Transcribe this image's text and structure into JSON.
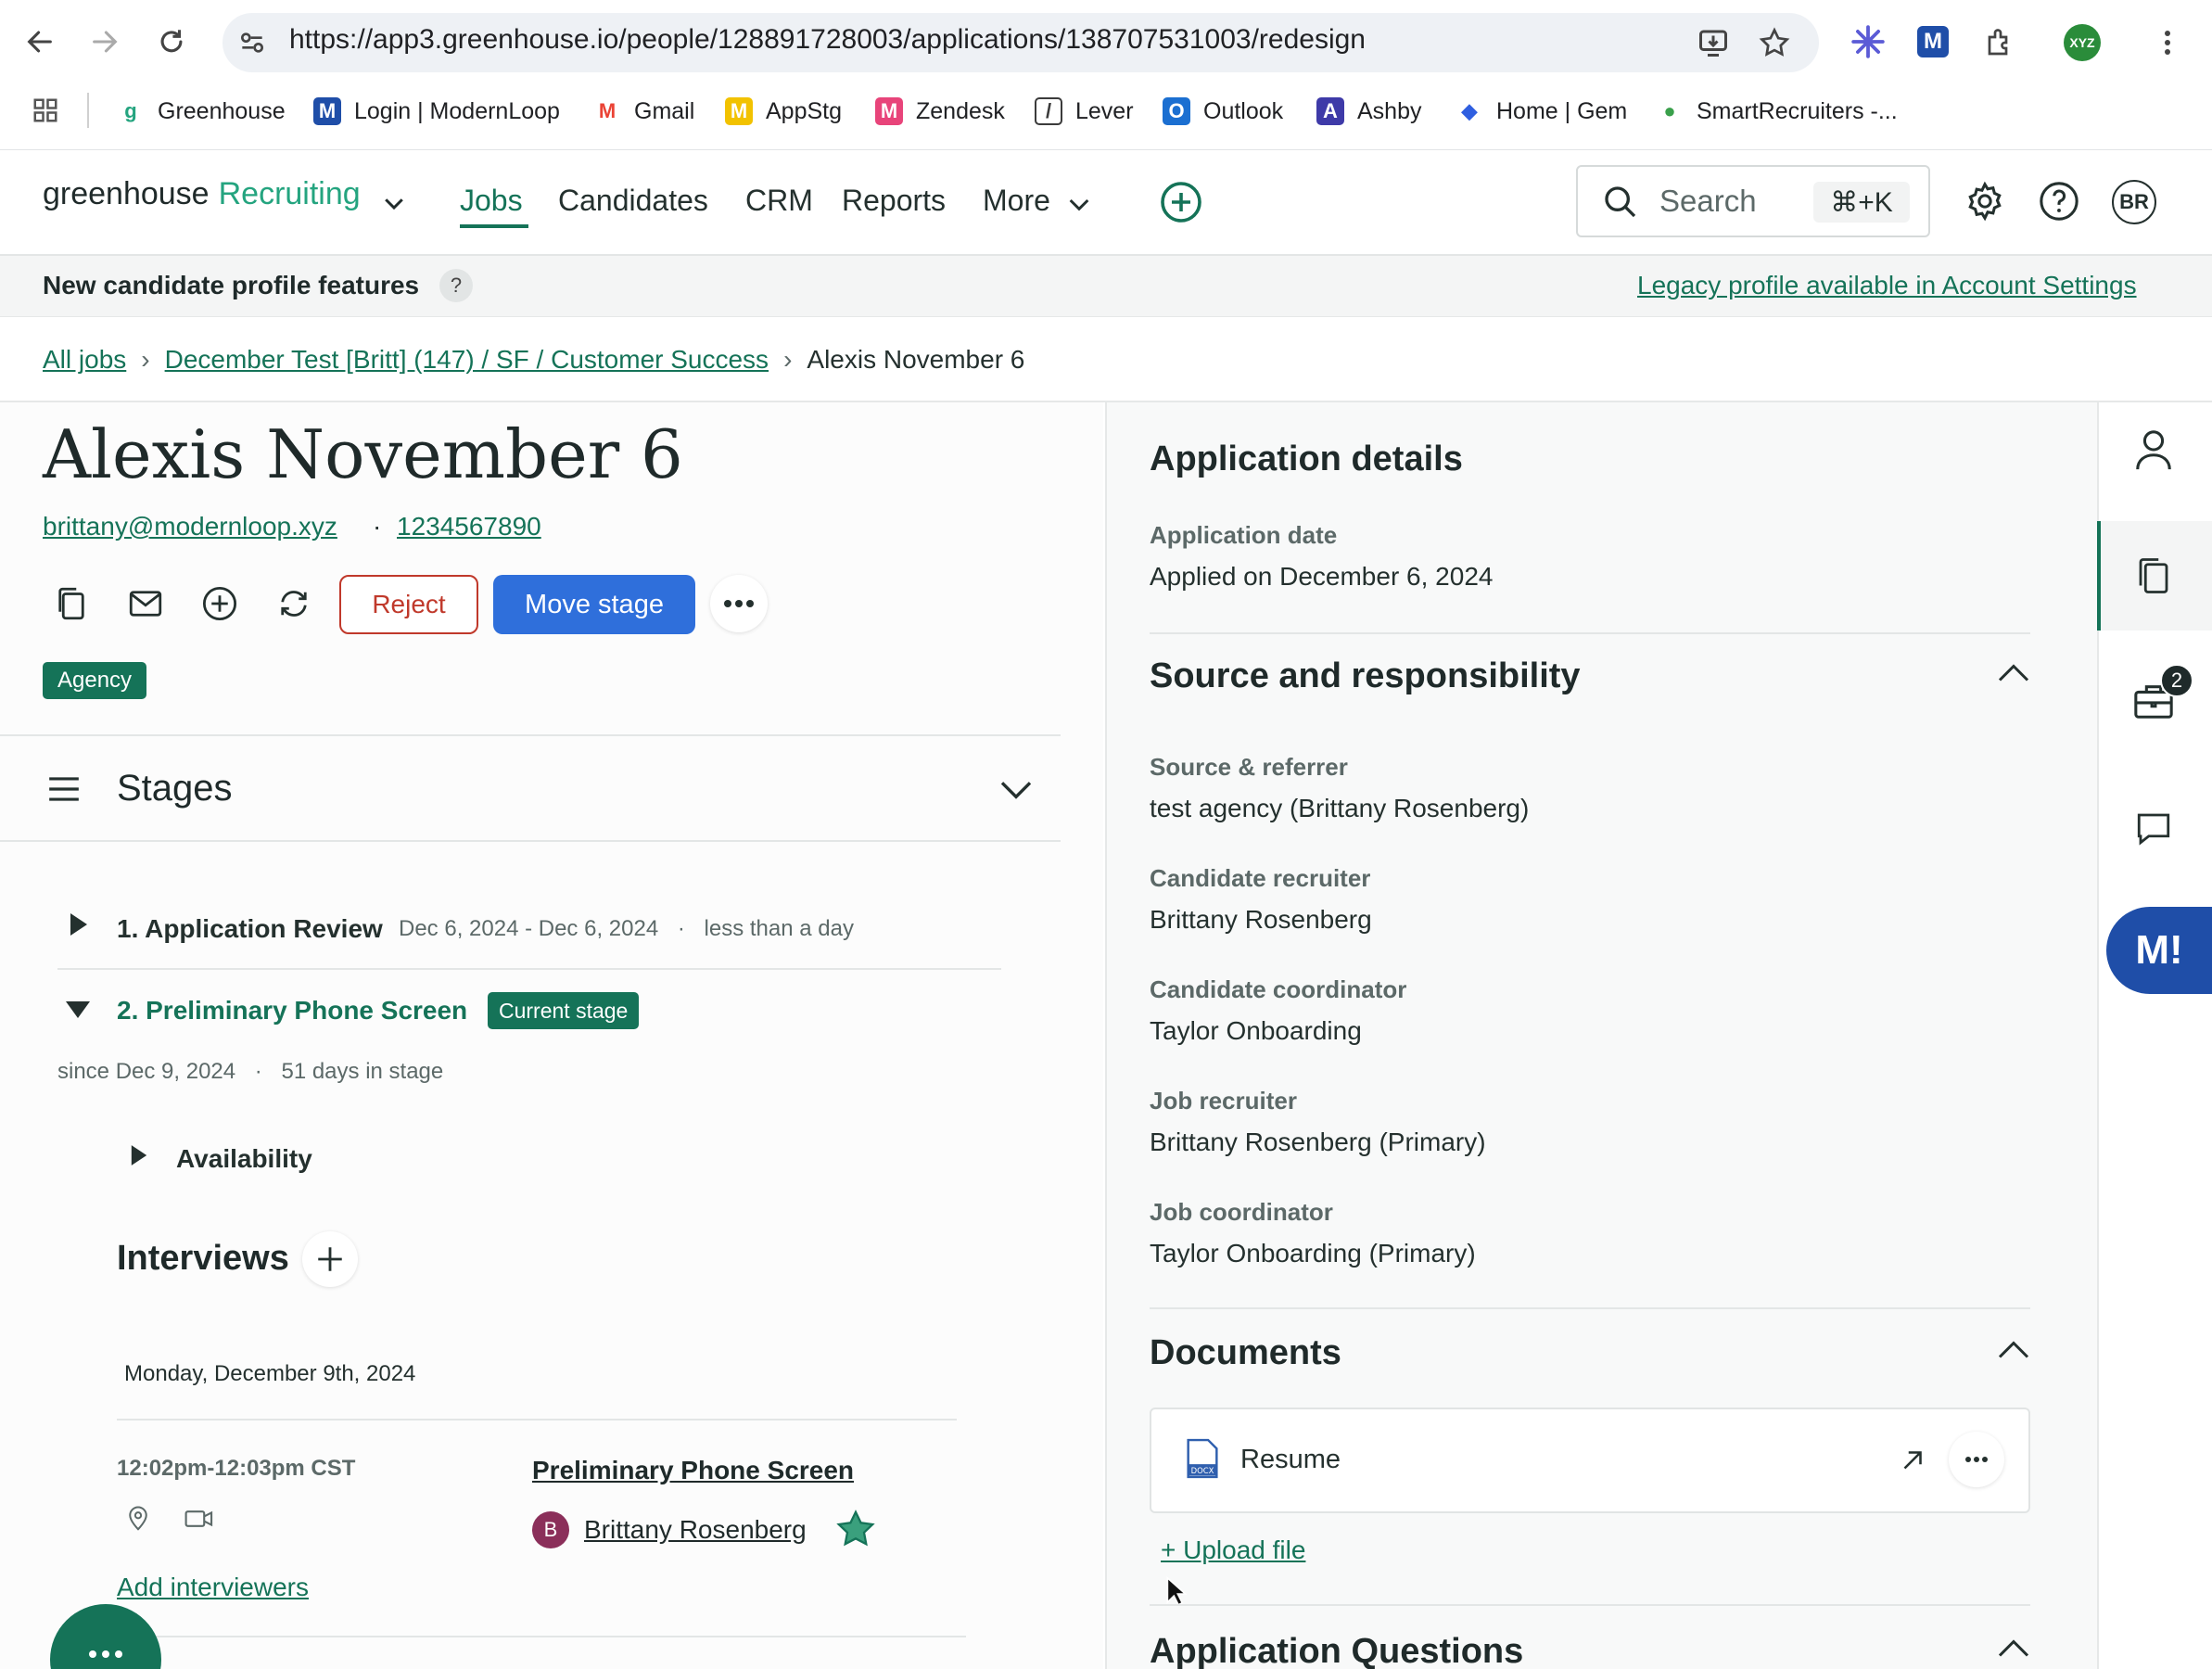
{
  "browser": {
    "url": "https://app3.greenhouse.io/people/128891728003/applications/138707531003/redesign",
    "profile_badge": "XYZ",
    "bookmarks": [
      {
        "label": "Greenhouse",
        "color": "#24a47f",
        "icon": "G"
      },
      {
        "label": "Login | ModernLoop",
        "color": "#1f4ea8",
        "icon": "M"
      },
      {
        "label": "Gmail",
        "color": "#ea4335",
        "icon": "M"
      },
      {
        "label": "AppStg",
        "color": "#f2c200",
        "icon": "M"
      },
      {
        "label": "Zendesk",
        "color": "#e8447a",
        "icon": "M"
      },
      {
        "label": "Lever",
        "color": "#3b3b3b",
        "icon": "/"
      },
      {
        "label": "Outlook",
        "color": "#1b6fd1",
        "icon": "O"
      },
      {
        "label": "Ashby",
        "color": "#3e3aa8",
        "icon": "A"
      },
      {
        "label": "Home | Gem",
        "color": "#2f5fe0",
        "icon": "◆"
      },
      {
        "label": "SmartRecruiters -...",
        "color": "#3aa04b",
        "icon": "●"
      }
    ]
  },
  "header": {
    "logo_text": "greenhouse",
    "logo_product": "Recruiting",
    "nav": [
      "Jobs",
      "Candidates",
      "CRM",
      "Reports",
      "More"
    ],
    "search_placeholder": "Search",
    "search_shortcut": "⌘+K",
    "avatar_initials": "BR"
  },
  "banner": {
    "title": "New candidate profile features",
    "help": "?",
    "legacy_link": "Legacy profile available in Account Settings"
  },
  "breadcrumb": {
    "all_jobs": "All jobs",
    "job": "December Test [Britt] (147) / SF / Customer Success",
    "current": "Alexis November 6"
  },
  "candidate": {
    "name": "Alexis November 6",
    "email": "brittany@modernloop.xyz",
    "phone": "1234567890",
    "reject_label": "Reject",
    "move_stage_label": "Move stage",
    "tag": "Agency"
  },
  "stages": {
    "title": "Stages",
    "items": [
      {
        "name": "1. Application Review",
        "dates": "Dec 6, 2024 - Dec 6, 2024",
        "duration": "less than a day"
      },
      {
        "name": "2. Preliminary Phone Screen",
        "badge": "Current stage",
        "since": "since Dec 9, 2024",
        "days": "51 days in stage"
      }
    ],
    "availability_label": "Availability",
    "interviews_title": "Interviews",
    "interview_date": "Monday, December 9th, 2024",
    "interview_time": "12:02pm-12:03pm CST",
    "interview_name": "Preliminary Phone Screen",
    "interviewer_initial": "B",
    "interviewer_name": "Brittany Rosenberg",
    "add_interviewers": "Add interviewers"
  },
  "application_details": {
    "title": "Application details",
    "date_label": "Application date",
    "date_value": "Applied on December 6, 2024"
  },
  "source": {
    "title": "Source and responsibility",
    "fields": [
      {
        "label": "Source & referrer",
        "value": "test agency (Brittany Rosenberg)"
      },
      {
        "label": "Candidate recruiter",
        "value": "Brittany Rosenberg"
      },
      {
        "label": "Candidate coordinator",
        "value": "Taylor Onboarding"
      },
      {
        "label": "Job recruiter",
        "value": "Brittany Rosenberg (Primary)"
      },
      {
        "label": "Job coordinator",
        "value": "Taylor Onboarding (Primary)"
      }
    ]
  },
  "documents": {
    "title": "Documents",
    "resume_label": "Resume",
    "upload_label": "+ Upload file"
  },
  "questions": {
    "title": "Application Questions"
  },
  "rail": {
    "jobs_badge": "2",
    "ml_label": "M!"
  },
  "colors": {
    "brand_green": "#157358",
    "primary_blue": "#2f6fdb",
    "reject_red": "#c0392b"
  }
}
